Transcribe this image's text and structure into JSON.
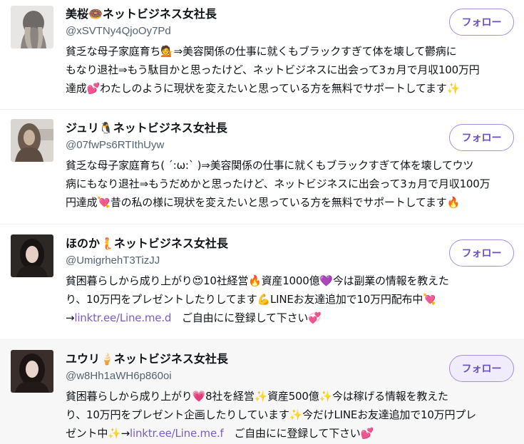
{
  "users": [
    {
      "name": "美桜🍩ネットビジネス女社長",
      "handle": "@xSVTNy4QjoOy7Pd",
      "bio_lines": [
        "貧乏な母子家庭育ち💁⇒美容関係の仕事に就くもブラックすぎて体を壊して鬱病に",
        "もなり退社⇒もう駄目かと思ったけど、ネットビジネスに出会って3ヵ月で月収100万円",
        "達成💕わたしのように現状を変えたいと思っている方を無料でサポートしてます✨"
      ],
      "follow_label": "フォロー"
    },
    {
      "name": "ジュリ🐧ネットビジネス女社長",
      "handle": "@07fwPs6RTIthUyw",
      "bio_lines": [
        "貧乏な母子家庭育ち( ´:ω:` )⇒美容関係の仕事に就くもブラックすぎて体を壊してウツ",
        "病にもなり退社⇒もうだめかと思ったけど、ネットビジネスに出会って3ヵ月で月収100万",
        "円達成💘昔の私の様に現状を変えたいと思っている方を無料でサポートしてます🔥"
      ],
      "follow_label": "フォロー"
    },
    {
      "name": "ほのか🧜ネットビジネス女社長",
      "handle": "@UmigrhehT3TizJJ",
      "bio_lines": [
        "貧困暮らしから成り上がり😍10社経営🔥資産1000億💜今は副業の情報を教えた",
        "り、10万円をプレゼントしたりしてます💪LINEお友達追加で10万円配布中💘"
      ],
      "bio_link_prefix": "→",
      "bio_link": "linktr.ee/Line.me.d",
      "bio_link_suffix": "　ご自由にに登録して下さい💞",
      "follow_label": "フォロー"
    },
    {
      "name": "ユウリ🍦ネットビジネス女社長",
      "handle": "@w8Hh1aWH6p860oi",
      "bio_lines": [
        "貧困暮らしから成り上がり💗8社を経営✨資産500億✨今は稼げる情報を教えた",
        "り、10万円をプレゼント企画したりしています✨今だけLINEお友達追加で10万円プレ"
      ],
      "bio_link_prefix": "ゼント中✨→",
      "bio_link": "linktr.ee/Line.me.f",
      "bio_link_suffix": "　ご自由にに登録して下さい💕",
      "follow_label": "フォロー"
    }
  ],
  "colors": {
    "accent": "#6a4fbf",
    "link": "#7b5cc7",
    "handle": "#536471",
    "hover_row": "#f7f7f7"
  }
}
